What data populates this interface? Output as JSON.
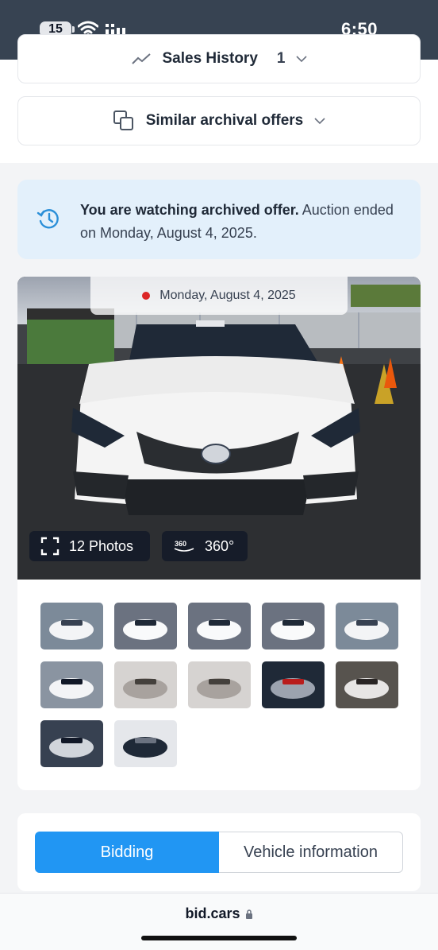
{
  "status_bar": {
    "battery": "15",
    "time": "6:50"
  },
  "sections": {
    "sales_history": {
      "label": "Sales History",
      "count": "1"
    },
    "similar_offers": {
      "label": "Similar archival offers"
    }
  },
  "notice": {
    "bold": "You are watching archived offer.",
    "text": " Auction ended on Monday, August 4, 2025."
  },
  "photo": {
    "date": "Monday, August 4, 2025",
    "photos_label": "12 Photos",
    "three60_label": "360°",
    "three60_badge": "360"
  },
  "thumbnails": [
    {
      "icon": "car-front-thumb"
    },
    {
      "icon": "car-side-thumb"
    },
    {
      "icon": "car-side-thumb"
    },
    {
      "icon": "car-side-thumb"
    },
    {
      "icon": "car-front-thumb"
    },
    {
      "icon": "car-rear-thumb"
    },
    {
      "icon": "interior-seat-thumb"
    },
    {
      "icon": "interior-seat-thumb"
    },
    {
      "icon": "dashboard-gauge-thumb"
    },
    {
      "icon": "interior-rear-thumb"
    },
    {
      "icon": "engine-bay-thumb"
    },
    {
      "icon": "door-label-thumb"
    }
  ],
  "tabs": {
    "bidding": "Bidding",
    "vehicle": "Vehicle information"
  },
  "browser": {
    "url": "bid.cars"
  },
  "colors": {
    "accent": "#2196f3",
    "notice_bg": "#e3f0fb",
    "status_bar": "#374352"
  }
}
